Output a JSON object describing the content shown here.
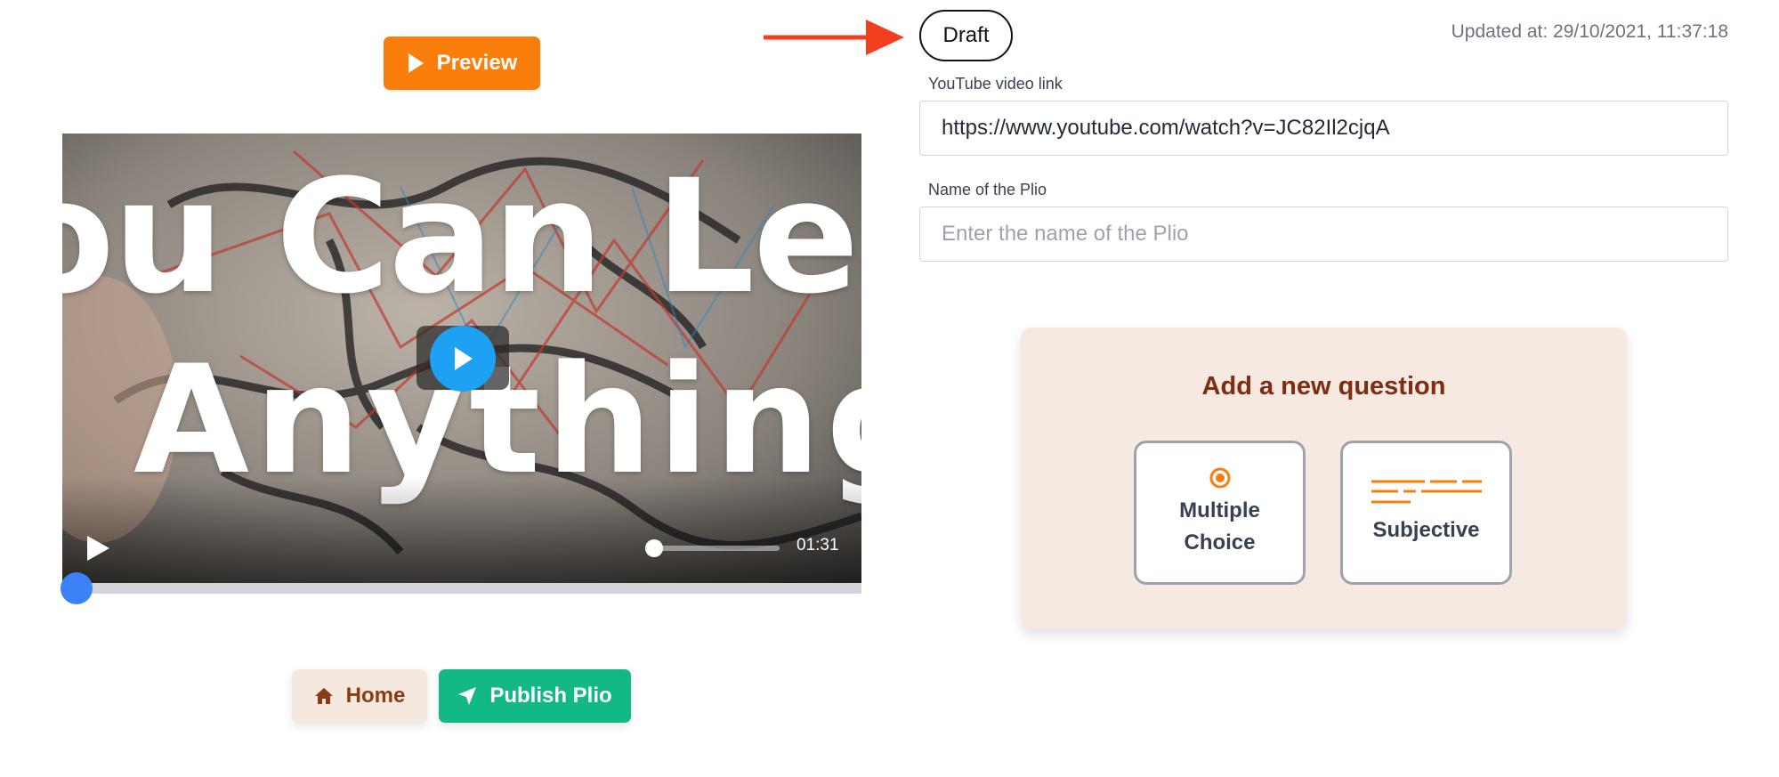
{
  "header": {
    "preview_label": "Preview",
    "status_badge": "Draft",
    "updated_at": "Updated at: 29/10/2021, 11:37:18"
  },
  "video": {
    "thumbnail_text_line1": "ou Can Lear",
    "thumbnail_text_line2": "Anything",
    "duration": "01:31",
    "progress_fraction": 0.0,
    "volume_fraction": 0.0
  },
  "form": {
    "youtube_label": "YouTube video link",
    "youtube_value": "https://www.youtube.com/watch?v=JC82Il2cjqA",
    "name_label": "Name of the Plio",
    "name_placeholder": "Enter the name of the Plio",
    "name_value": ""
  },
  "question_card": {
    "title": "Add a new question",
    "options": [
      {
        "label_line1": "Multiple",
        "label_line2": "Choice",
        "icon": "radio-icon"
      },
      {
        "label": "Subjective",
        "icon": "text-lines-icon"
      }
    ]
  },
  "footer": {
    "home_label": "Home",
    "publish_label": "Publish Plio"
  },
  "colors": {
    "preview": "#f97e0b",
    "publish": "#12b886",
    "home_bg": "#f5e8df",
    "accent_arrow": "#f43f1f",
    "card_bg": "#f5e9e1",
    "progress": "#3b82f6",
    "video_play": "#1da1f2"
  }
}
